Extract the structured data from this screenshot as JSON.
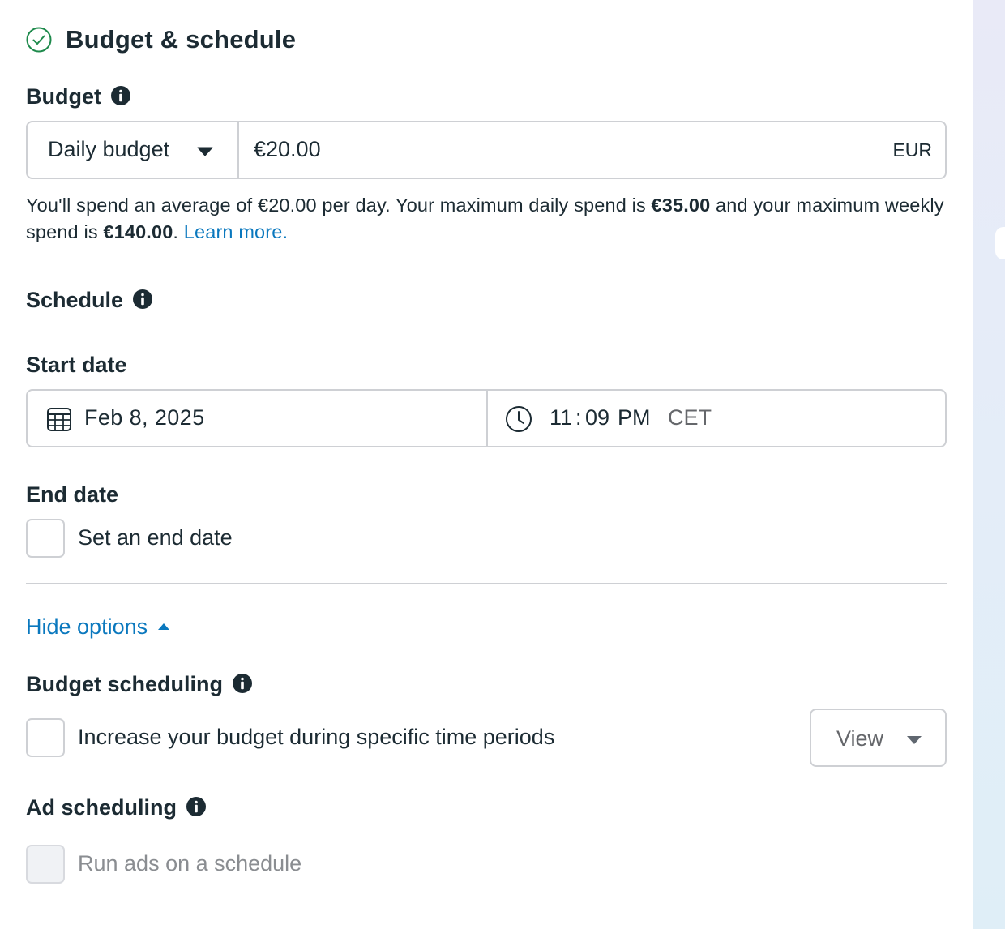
{
  "section": {
    "title": "Budget & schedule"
  },
  "budget": {
    "heading": "Budget",
    "type_label": "Daily budget",
    "amount": "€20.00",
    "currency": "EUR",
    "description_part1": "You'll spend an average of €20.00 per day. Your maximum daily spend is ",
    "max_daily": "€35.00",
    "description_part2": " and your maximum weekly spend is ",
    "max_weekly": "€140.00",
    "description_part3": ".",
    "learn_more": "Learn more."
  },
  "schedule": {
    "heading": "Schedule",
    "start_date_label": "Start date",
    "start_date": "Feb 8, 2025",
    "start_hour": "11",
    "start_minute": "09",
    "start_ampm": "PM",
    "timezone": "CET",
    "end_date_label": "End date",
    "end_date_checkbox_label": "Set an end date"
  },
  "options": {
    "toggle_label": "Hide options"
  },
  "budget_scheduling": {
    "heading": "Budget scheduling",
    "checkbox_label": "Increase your budget during specific time periods",
    "view_button": "View"
  },
  "ad_scheduling": {
    "heading": "Ad scheduling",
    "checkbox_label": "Run ads on a schedule"
  },
  "colors": {
    "success_green": "#1e8a4c",
    "link_blue": "#0a78be",
    "text_dark": "#1c2b33",
    "border": "#ced0d4"
  }
}
